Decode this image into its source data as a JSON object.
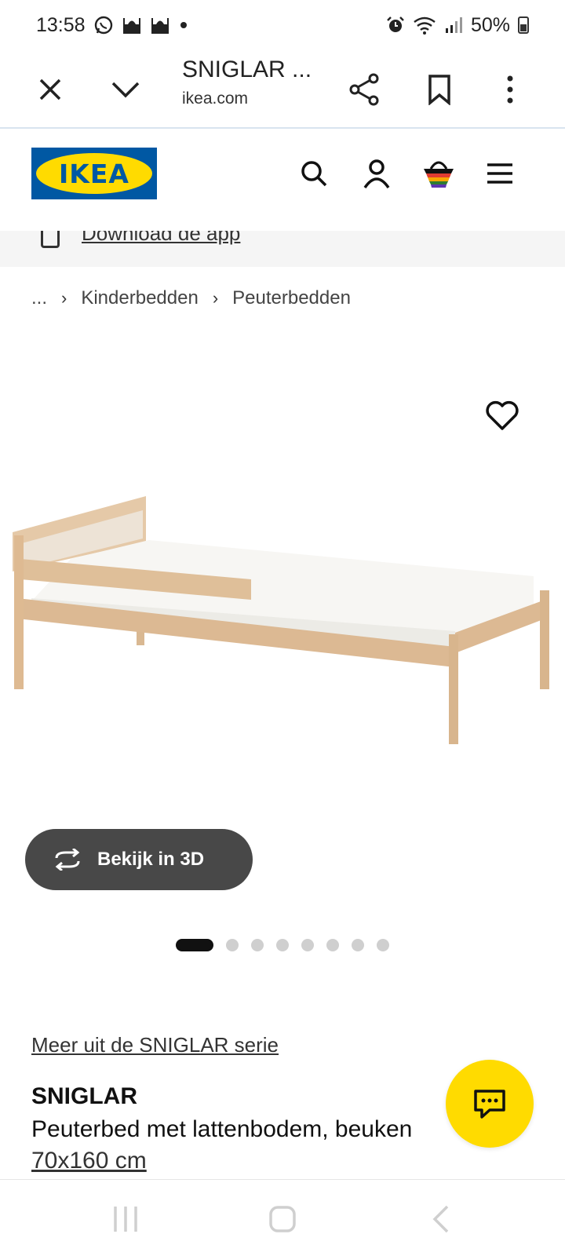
{
  "status_bar": {
    "time": "13:58",
    "battery": "50%",
    "icons": [
      "whatsapp-icon",
      "mosque-icon",
      "mosque-icon",
      "dot-icon",
      "alarm-icon",
      "wifi-icon",
      "signal-icon",
      "battery-icon"
    ]
  },
  "browser": {
    "tab_title": "SNIGLAR ...",
    "domain": "ikea.com",
    "buttons": [
      "close-icon",
      "chevron-down-icon",
      "share-icon",
      "bookmark-icon",
      "more-icon"
    ]
  },
  "header": {
    "logo_text": "IKEA",
    "icons": [
      "search-icon",
      "user-icon",
      "basket-icon",
      "menu-icon"
    ],
    "colors": {
      "brand_blue": "#0058a3",
      "brand_yellow": "#ffdb00"
    }
  },
  "app_banner": {
    "link": "Download de app"
  },
  "breadcrumb": {
    "ellipsis": "...",
    "items": [
      "Kinderbedden",
      "Peuterbedden"
    ]
  },
  "media": {
    "view_3d_label": "Bekijk in 3D",
    "pager": {
      "count": 8,
      "active": 1
    }
  },
  "product": {
    "series_link": "Meer uit de SNIGLAR serie",
    "name": "SNIGLAR",
    "description": "Peuterbed met lattenbodem, beuken",
    "size": "70x160 cm"
  },
  "nav_bar": {
    "buttons": [
      "recents-icon",
      "home-icon",
      "back-icon"
    ]
  }
}
